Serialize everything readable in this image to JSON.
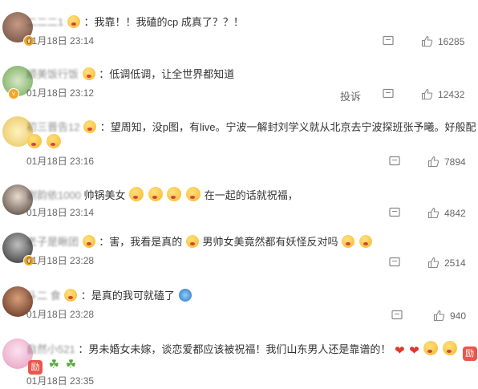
{
  "comments": [
    {
      "username": "二二二1",
      "text": "：我靠！！我磕的cp 成真了？？！",
      "date": "01月18日 23:14",
      "likes": "16285"
    },
    {
      "username": "顺美饭行饭",
      "text": "：低调低调，让全世界都知道",
      "date": "01月18日 23:12",
      "likes": "12432",
      "report": "投诉"
    },
    {
      "username": "初三晋告12",
      "text_line1": "：望周知，没p图，有live。宁波一解封刘学义就从北京去宁波探班张予曦。好般配",
      "date": "01月18日 23:16",
      "likes": "7894"
    },
    {
      "username": "谢韵依1000",
      "text_a": "帅锅美女",
      "text_b": "在一起的话就祝福，",
      "date": "01月18日 23:14",
      "likes": "4842"
    },
    {
      "username": "老子是瞅团",
      "text_a": "：害，我看是真的",
      "text_b": "男帅女美竟然都有妖怪反对吗",
      "date": "01月18日 23:28",
      "likes": "2514"
    },
    {
      "username": "斗二 食",
      "text": "：是真的我可就磕了",
      "date": "01月18日 23:28",
      "likes": "940"
    },
    {
      "username": "自然小521",
      "text": "：男未婚女未嫁，谈恋爱都应该被祝福！我们山东男人还是靠谱的！",
      "date": "01月18日 23:35",
      "likes": ""
    }
  ],
  "icons": {
    "reply": "comment-icon",
    "like": "thumbs-up-icon"
  },
  "colors": {
    "badge": "#f5a623",
    "text": "#333333",
    "muted": "#666666"
  }
}
